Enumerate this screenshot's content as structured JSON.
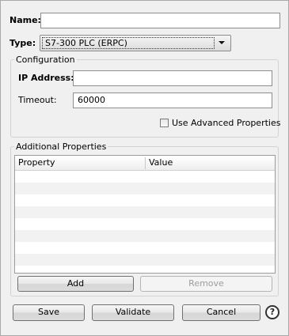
{
  "name_field": {
    "label": "Name:",
    "value": ""
  },
  "type_field": {
    "label": "Type:",
    "selected": "S7-300 PLC (ERPC)",
    "icon": "chevron-down-icon"
  },
  "configuration": {
    "title": "Configuration",
    "ip_label": "IP Address:",
    "ip_value": "",
    "timeout_label": "Timeout:",
    "timeout_value": "60000",
    "advanced_label": "Use Advanced Properties",
    "advanced_checked": false
  },
  "additional": {
    "title": "Additional Properties",
    "columns": [
      "Property",
      "Value"
    ],
    "rows": [],
    "add_label": "Add",
    "remove_label": "Remove"
  },
  "footer": {
    "save_label": "Save",
    "validate_label": "Validate",
    "cancel_label": "Cancel",
    "help_glyph": "?",
    "help_icon": "help-icon"
  }
}
